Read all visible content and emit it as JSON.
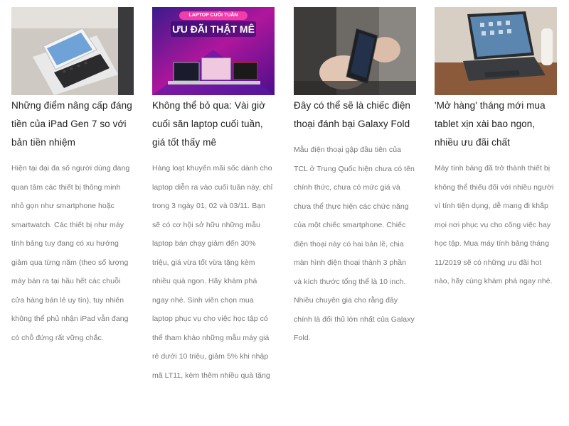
{
  "articles": [
    {
      "image_alt": "iPad Gen 7 with keyboard",
      "title": "Những điểm nâng cấp đáng tiền của iPad Gen 7 so với bản tiền nhiệm",
      "excerpt": "Hiện tại đại đa số người dùng đang quan tâm các thiết bị thông minh nhỏ gọn như smartphone hoặc smartwatch. Các thiết bị như máy tính bảng tuy đang có xu hướng giảm qua từng năm (theo số lượng máy bán ra tại hầu hết các chuỗi cửa hàng bán lẻ uy tín), tuy nhiên không thể phủ nhận iPad vẫn đang có chỗ đứng rất vững chắc."
    },
    {
      "image_alt": "Laptop cuối tuần ưu đãi thật mê banner",
      "banner_line1": "LAPTOP CUỐI TUẦN",
      "banner_line2": "ƯU ĐÃI THẬT MÊ",
      "title": "Không thể bỏ qua: Vài giờ cuối săn laptop cuối tuần, giá tốt thấy mê",
      "excerpt": "Hàng loạt khuyến mãi sốc dành cho laptop diễn ra vào cuối tuần này, chỉ trong 3 ngày 01, 02 và 03/11. Bạn sẽ có cơ hội sở hữu những mẫu laptop bán chạy giảm đến 30% triệu, giá vừa tốt vừa tặng kèm nhiều quà ngon. Hãy khám phá ngay nhé. Sinh viên chọn mua laptop phục vụ cho việc học tập có thể tham khảo những mẫu máy giá rẻ dưới 10 triệu, giảm 5% khi nhập mã LT11, kèm thêm nhiều quà tặng"
    },
    {
      "image_alt": "TCL foldable phone in hand",
      "title": "Đây có thể sẽ là chiếc điện thoại đánh bại Galaxy Fold",
      "excerpt": "Mẫu điện thoại gập đầu tiên của TCL ở Trung Quốc hiện chưa có tên chính thức, chưa có mức giá và chưa thể thực hiện các chức năng của một chiếc smartphone. Chiếc điện thoại này có hai bản lề, chia màn hình điện thoại thành 3 phần và kích thước tổng thể là 10 inch. Nhiều chuyên gia cho rằng đây chính là đối thủ lớn nhất của Galaxy Fold."
    },
    {
      "image_alt": "Tablet with keyboard on desk",
      "title": "'Mở hàng' tháng mới mua tablet xịn xài bao ngon, nhiều ưu đãi chất",
      "excerpt": "Máy tính bảng đã trở thành thiết bị không thể thiếu đối với nhiều người vì tính tiện dụng, dễ mang đi khắp mọi nơi phục vụ cho công việc hay học tập. Mua máy tính bảng tháng 11/2019 sẽ có những ưu đãi hot nào, hãy cùng khám phá ngay nhé."
    }
  ]
}
